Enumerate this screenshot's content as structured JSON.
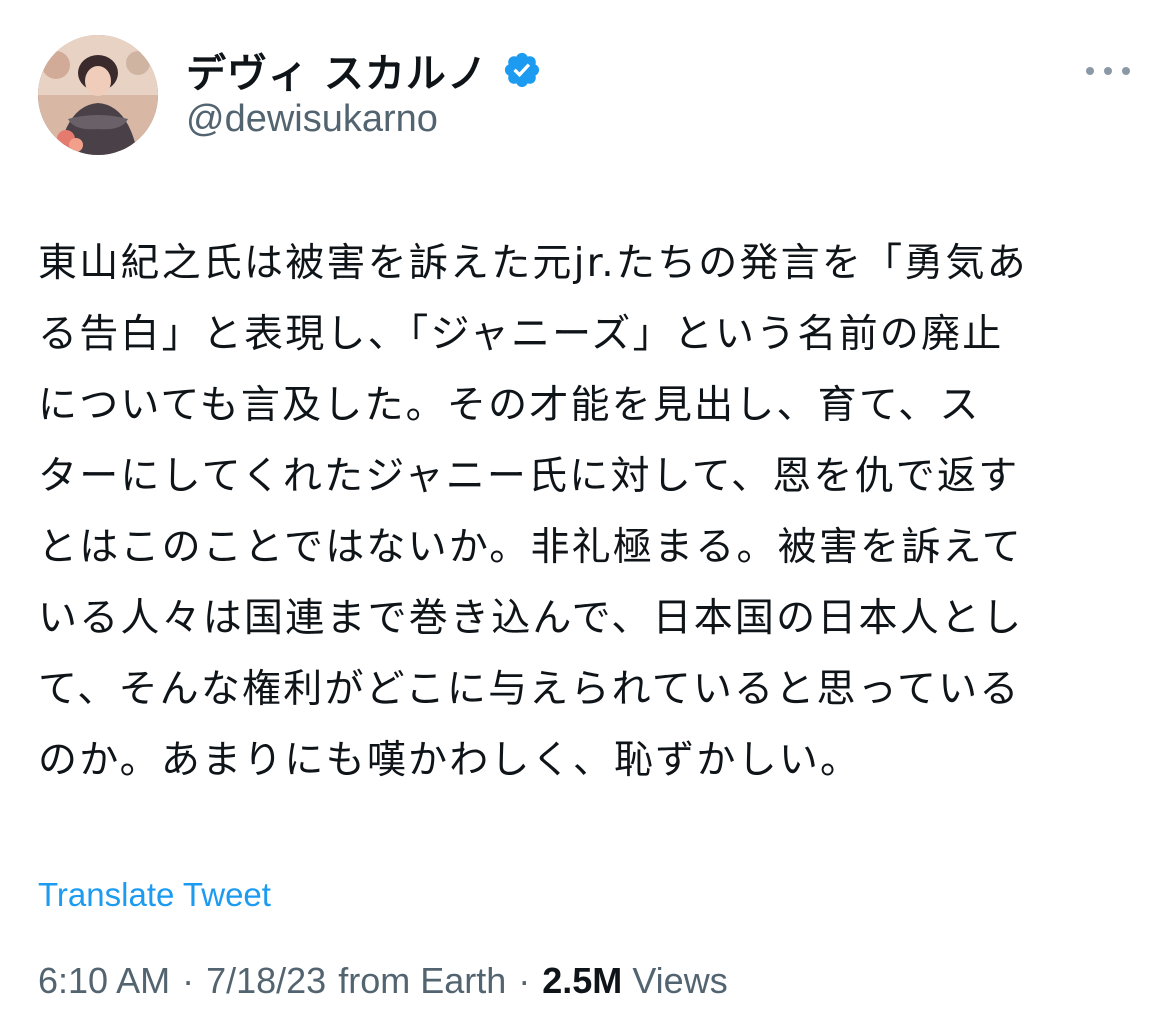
{
  "author": {
    "display_name": "デヴィ スカルノ",
    "handle": "@dewisukarno",
    "verified_icon": "verified-badge-icon",
    "avatar_icon": "avatar"
  },
  "menu": {
    "more_icon": "more-horizontal-icon"
  },
  "tweet": {
    "lines": [
      "東山紀之氏は被害を訴えた元jr.たちの発言を「勇気あ",
      "る告白」と表現し、「ジャニーズ」という名前の廃止",
      "についても言及した。その才能を見出し、育て、ス",
      "ターにしてくれたジャニー氏に対して、恩を仇で返す",
      "とはこのことではないか。非礼極まる。被害を訴えて",
      "いる人々は国連まで巻き込んで、日本国の日本人とし",
      "て、そんな権利がどこに与えられていると思っている",
      "のか。あまりにも嘆かわしく、恥ずかしい。"
    ]
  },
  "translate_label": "Translate Tweet",
  "meta": {
    "time": "6:10 AM",
    "date": "7/18/23",
    "source": "from Earth",
    "views_count": "2.5M",
    "views_label": "Views"
  },
  "colors": {
    "text": "#0f1419",
    "secondary": "#536471",
    "link": "#1d9bf0",
    "verified": "#1d9bf0"
  }
}
